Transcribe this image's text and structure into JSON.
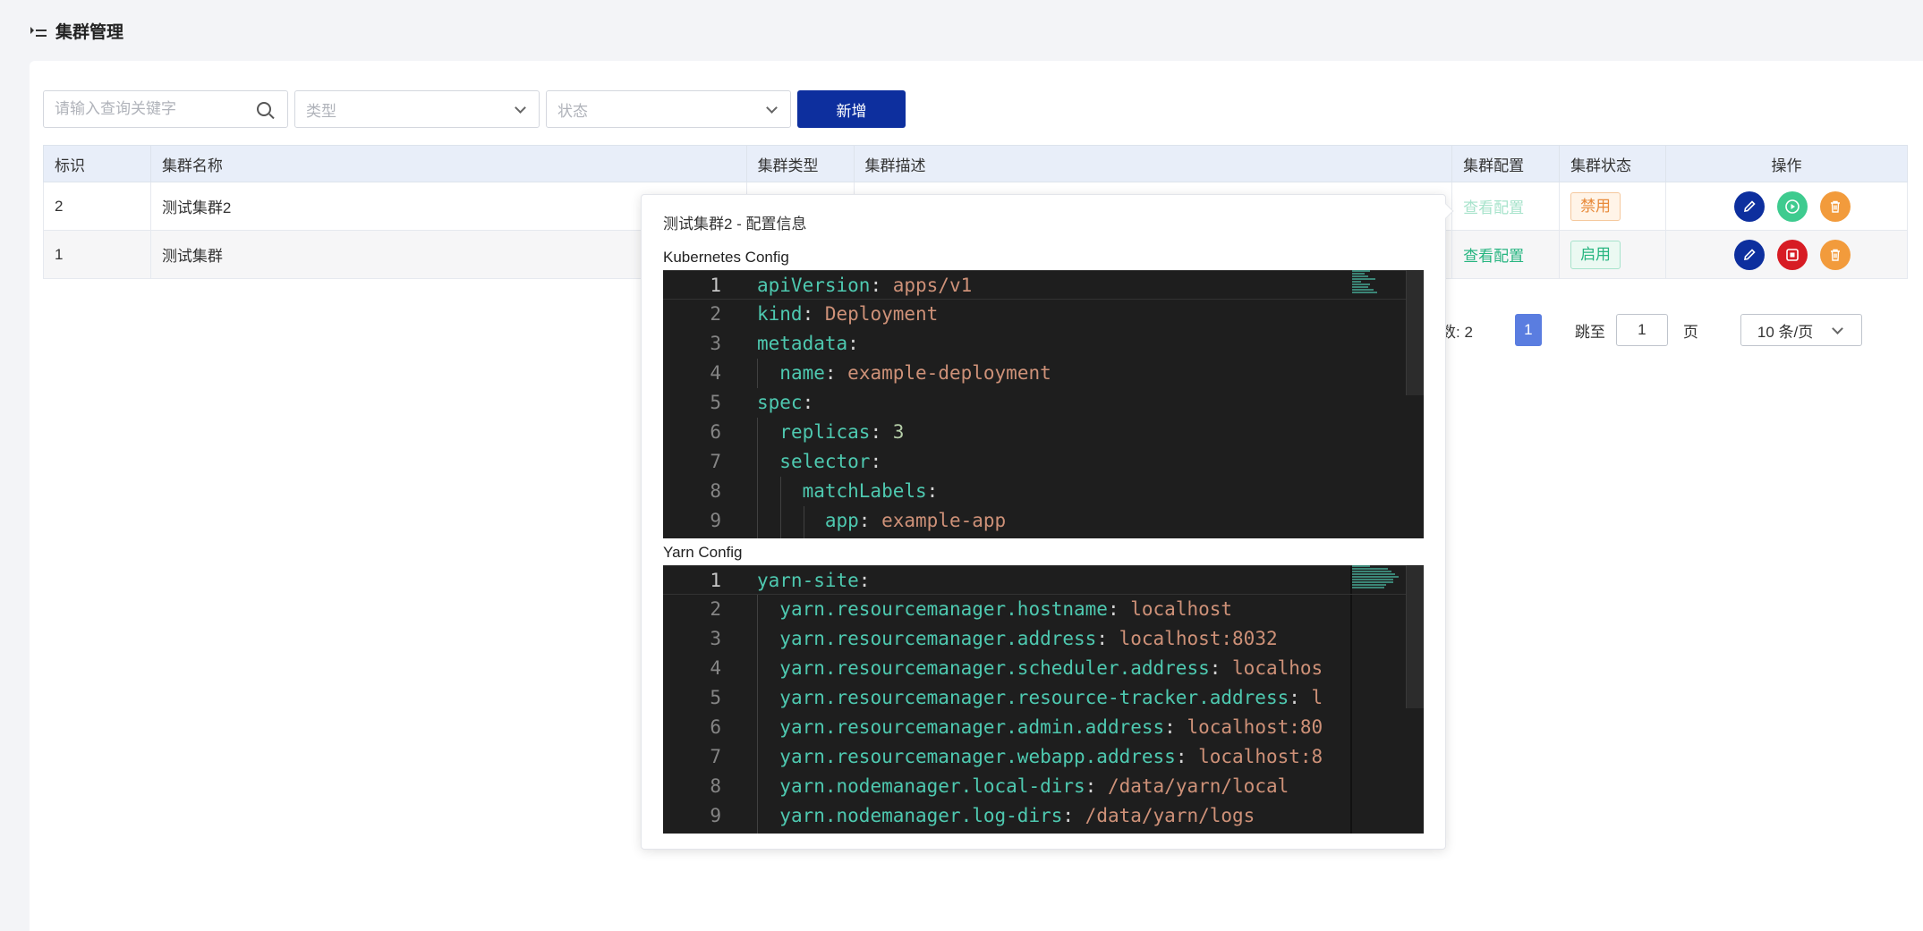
{
  "header": {
    "title": "集群管理",
    "menu_icon": "outdent-menu-icon"
  },
  "filters": {
    "search_placeholder": "请输入查询关键字",
    "type_placeholder": "类型",
    "status_placeholder": "状态",
    "add_label": "新增"
  },
  "table": {
    "columns": [
      "标识",
      "集群名称",
      "集群类型",
      "集群描述",
      "集群配置",
      "集群状态",
      "操作"
    ],
    "rows": [
      {
        "id": "2",
        "name": "测试集群2",
        "config_link": "查看配置",
        "status": "禁用",
        "toggle_icon": "play-circle-icon"
      },
      {
        "id": "1",
        "name": "测试集群",
        "config_link": "查看配置",
        "status": "启用",
        "toggle_icon": "stop-icon"
      }
    ]
  },
  "pagination": {
    "total_label": "数: 2",
    "current_page": "1",
    "jump_label": "跳至",
    "jump_value": "1",
    "jump_unit": "页",
    "page_size": "10 条/页"
  },
  "popover": {
    "title": "测试集群2 - 配置信息",
    "k8s_label": "Kubernetes Config",
    "yarn_label": "Yarn Config",
    "k8s_lines": [
      {
        "num": "1",
        "key": "apiVersion",
        "val": "apps/v1"
      },
      {
        "num": "2",
        "key": "kind",
        "val": "Deployment"
      },
      {
        "num": "3",
        "key": "metadata",
        "val": ""
      },
      {
        "num": "4",
        "key": "name",
        "val": "example-deployment"
      },
      {
        "num": "5",
        "key": "spec",
        "val": ""
      },
      {
        "num": "6",
        "key": "replicas",
        "val": "3"
      },
      {
        "num": "7",
        "key": "selector",
        "val": ""
      },
      {
        "num": "8",
        "key": "matchLabels",
        "val": ""
      },
      {
        "num": "9",
        "key": "app",
        "val": "example-app"
      }
    ],
    "yarn_lines": [
      {
        "num": "1",
        "key": "yarn-site",
        "val": ""
      },
      {
        "num": "2",
        "key": "yarn.resourcemanager.hostname",
        "val": "localhost"
      },
      {
        "num": "3",
        "key": "yarn.resourcemanager.address",
        "val": "localhost:8032"
      },
      {
        "num": "4",
        "key": "yarn.resourcemanager.scheduler.address",
        "val": "localhos"
      },
      {
        "num": "5",
        "key": "yarn.resourcemanager.resource-tracker.address",
        "val": "l"
      },
      {
        "num": "6",
        "key": "yarn.resourcemanager.admin.address",
        "val": "localhost:80"
      },
      {
        "num": "7",
        "key": "yarn.resourcemanager.webapp.address",
        "val": "localhost:8"
      },
      {
        "num": "8",
        "key": "yarn.nodemanager.local-dirs",
        "val": "/data/yarn/local"
      },
      {
        "num": "9",
        "key": "yarn.nodemanager.log-dirs",
        "val": "/data/yarn/logs"
      }
    ]
  }
}
